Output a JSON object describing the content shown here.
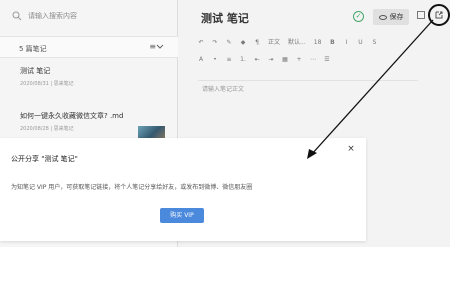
{
  "sidebar": {
    "search_placeholder": "请输入搜索内容",
    "note_count": "5 篇笔记",
    "sort_label": "≡",
    "notes": [
      {
        "title": "测试 笔记",
        "date": "2020/08/31 | 思来笔记"
      },
      {
        "title": "如何一键永久收藏微信文章? .md",
        "date": "2020/08/28 | 思来笔记"
      }
    ]
  },
  "editor": {
    "title": "测试 笔记",
    "save_label": "保存",
    "toolbar1": [
      "↶",
      "↷",
      "✎",
      "◆",
      "¶",
      "正文",
      "默认...",
      "18",
      "B",
      "I",
      "U",
      "S"
    ],
    "toolbar2": [
      "A",
      "•",
      "≡",
      "1.",
      "⇤",
      "⇥",
      "▦",
      "+",
      "⋯",
      "☰"
    ],
    "placeholder": "请输入笔记正文"
  },
  "modal": {
    "title": "公开分享 \"测试 笔记\"",
    "text": "为知笔记 VIP 用户，可获取笔记链接，将个人笔记分享给好友，或发布到微博、微信朋友圈",
    "button": "购买 VIP"
  },
  "colors": {
    "accent": "#4a89dc",
    "saved": "#49a86c"
  },
  "icons": [
    "search-icon",
    "sort-icon",
    "check-icon",
    "eye-icon",
    "expand-icon",
    "share-icon",
    "close-icon"
  ]
}
